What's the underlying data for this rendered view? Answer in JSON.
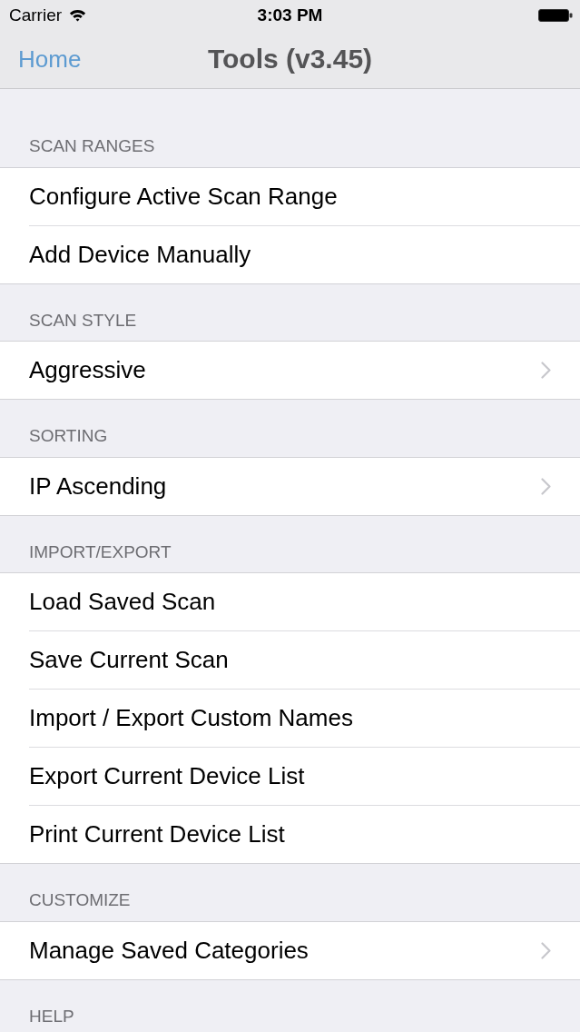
{
  "status_bar": {
    "carrier": "Carrier",
    "time": "3:03 PM"
  },
  "nav_bar": {
    "back_button": "Home",
    "title": "Tools (v3.45)"
  },
  "sections": [
    {
      "header": "SCAN RANGES",
      "rows": [
        {
          "label": "Configure Active Scan Range",
          "disclosure": false
        },
        {
          "label": "Add Device Manually",
          "disclosure": false
        }
      ]
    },
    {
      "header": "SCAN STYLE",
      "rows": [
        {
          "label": "Aggressive",
          "disclosure": true
        }
      ]
    },
    {
      "header": "SORTING",
      "rows": [
        {
          "label": "IP Ascending",
          "disclosure": true
        }
      ]
    },
    {
      "header": "IMPORT/EXPORT",
      "rows": [
        {
          "label": "Load Saved Scan",
          "disclosure": false
        },
        {
          "label": "Save Current Scan",
          "disclosure": false
        },
        {
          "label": "Import / Export Custom Names",
          "disclosure": false
        },
        {
          "label": "Export Current Device List",
          "disclosure": false
        },
        {
          "label": "Print Current Device List",
          "disclosure": false
        }
      ]
    },
    {
      "header": "CUSTOMIZE",
      "rows": [
        {
          "label": "Manage Saved Categories",
          "disclosure": true
        }
      ]
    },
    {
      "header": "HELP"
    }
  ]
}
